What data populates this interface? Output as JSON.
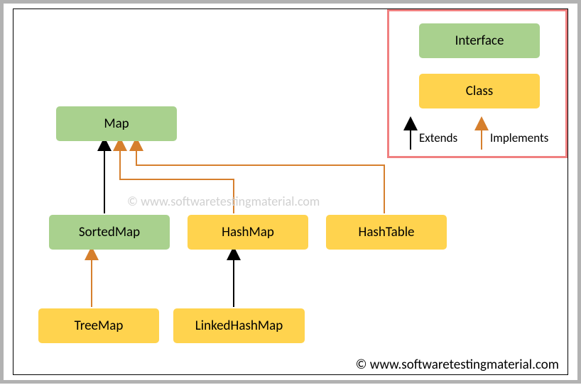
{
  "nodes": {
    "map": "Map",
    "sortedmap": "SortedMap",
    "hashmap": "HashMap",
    "hashtable": "HashTable",
    "treemap": "TreeMap",
    "linkedhashmap": "LinkedHashMap"
  },
  "legend": {
    "interface": "Interface",
    "class": "Class",
    "extends": "Extends",
    "implements": "Implements"
  },
  "watermark": "© www.softwaretestingmaterial.com",
  "copyright": "© www.softwaretestingmaterial.com",
  "colors": {
    "interface": "#a9d18e",
    "class": "#ffd34e",
    "extends_arrow": "#000000",
    "implements_arrow": "#d67f2d",
    "outer_border": "#b2b2b2",
    "legend_border": "#f08080"
  },
  "edges": [
    {
      "from": "sortedmap",
      "to": "map",
      "type": "extends"
    },
    {
      "from": "hashmap",
      "to": "map",
      "type": "implements"
    },
    {
      "from": "hashtable",
      "to": "map",
      "type": "implements"
    },
    {
      "from": "treemap",
      "to": "sortedmap",
      "type": "implements"
    },
    {
      "from": "linkedhashmap",
      "to": "hashmap",
      "type": "extends"
    }
  ]
}
